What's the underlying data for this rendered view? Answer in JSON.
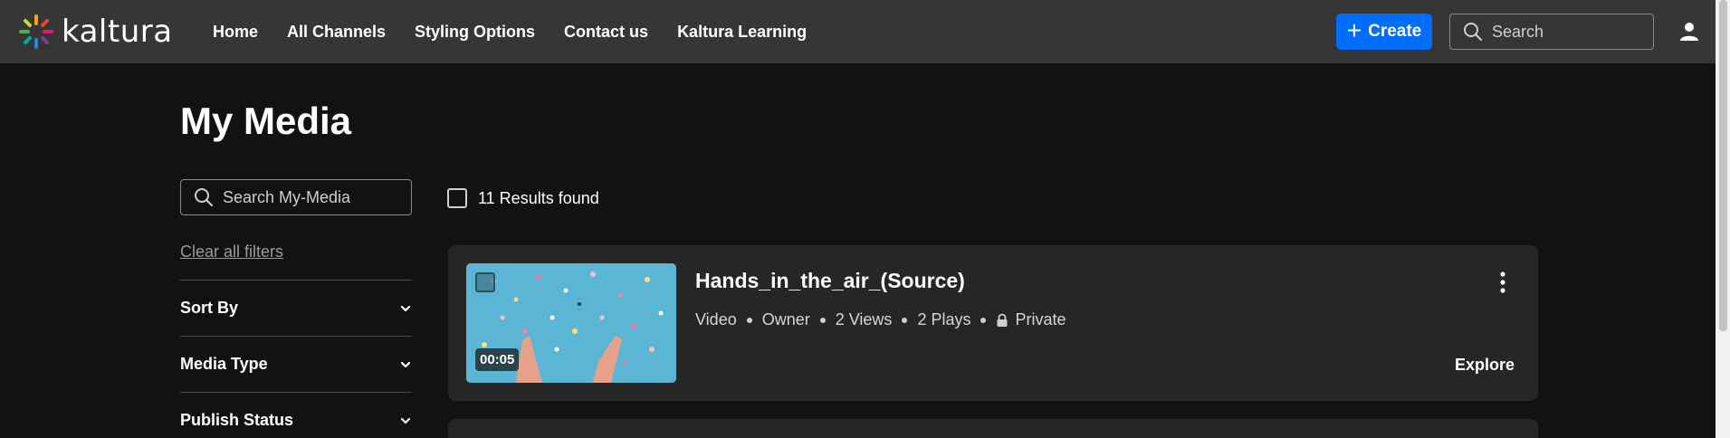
{
  "header": {
    "logo_text": "kaltura",
    "nav": [
      "Home",
      "All Channels",
      "Styling Options",
      "Contact us",
      "Kaltura Learning"
    ],
    "create_label": "Create",
    "search_placeholder": "Search"
  },
  "page": {
    "title": "My Media"
  },
  "sidebar": {
    "search_placeholder": "Search My-Media",
    "clear_filters": "Clear all filters",
    "filters": [
      "Sort By",
      "Media Type",
      "Publish Status"
    ]
  },
  "results": {
    "count_text": "11 Results found"
  },
  "media": [
    {
      "title": "Hands_in_the_air_(Source)",
      "duration": "00:05",
      "type": "Video",
      "role": "Owner",
      "views": "2 Views",
      "plays": "2 Plays",
      "privacy": "Private",
      "action": "Explore"
    }
  ],
  "colors": {
    "accent": "#006EFA",
    "header_bg": "#363636",
    "page_bg": "#121212",
    "card_bg": "#262626"
  },
  "icons": [
    "search-icon",
    "user-icon",
    "chevron-down-icon",
    "lock-icon",
    "kebab-menu-icon",
    "plus-icon"
  ]
}
